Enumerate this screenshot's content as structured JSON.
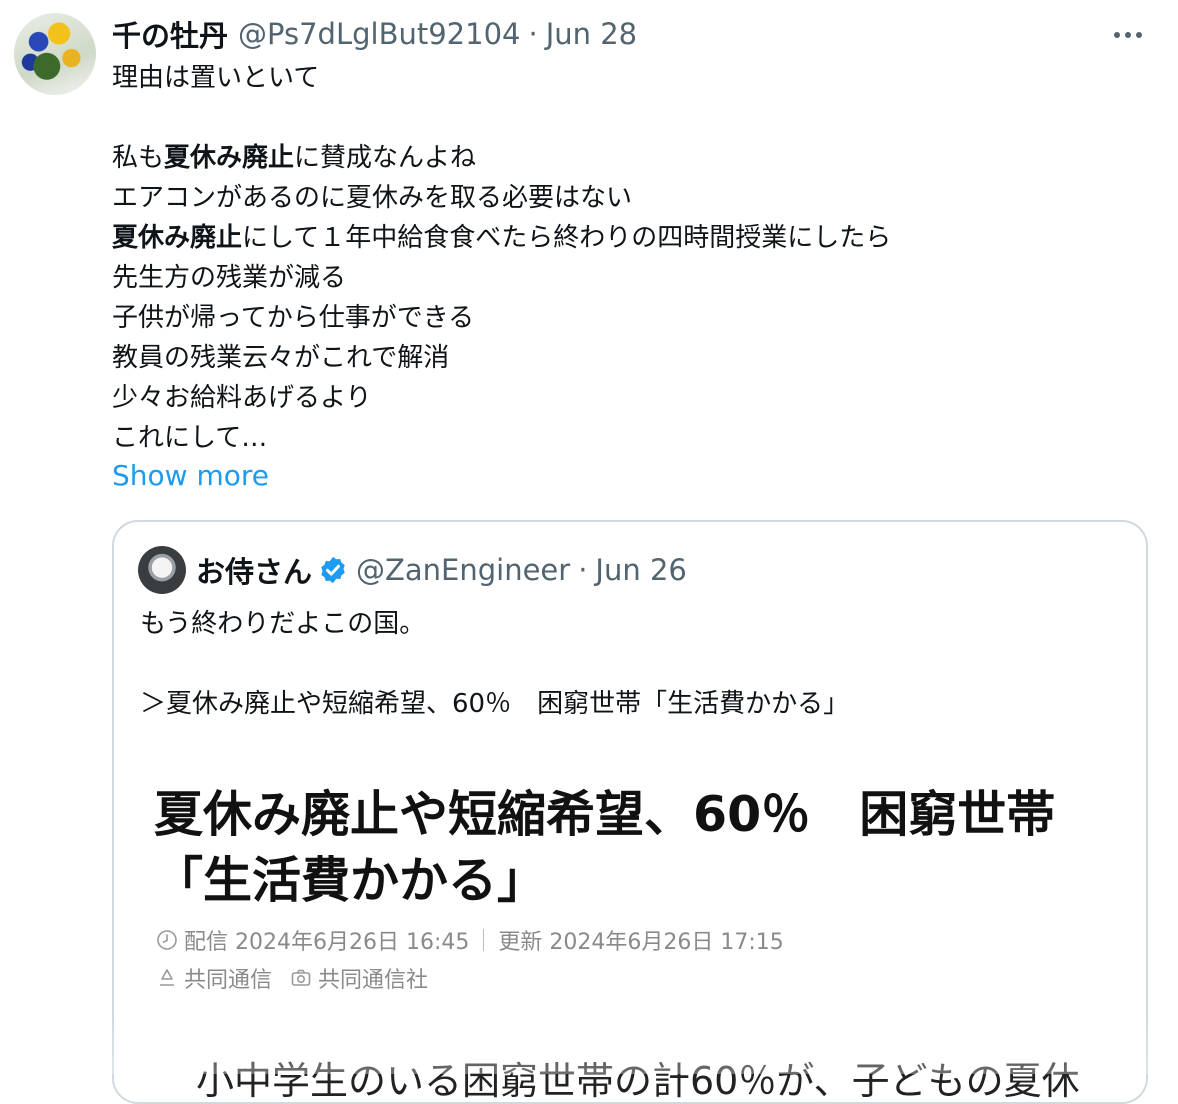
{
  "tweet": {
    "author": {
      "display_name": "千の牡丹",
      "handle": "@Ps7dLglBut92104",
      "separator": "·",
      "date": "Jun 28"
    },
    "body": {
      "line1": "理由は置いといて",
      "line3_pre": "私も",
      "line3_bold": "夏休み廃止",
      "line3_post": "に賛成なんよね",
      "line4": "エアコンがあるのに夏休みを取る必要はない",
      "line5_bold": "夏休み廃止",
      "line5_post": "にして１年中給食食べたら終わりの四時間授業にしたら",
      "line6": "先生方の残業が減る",
      "line7": "子供が帰ってから仕事ができる",
      "line8": "教員の残業云々がこれで解消",
      "line9": "少々お給料あげるより",
      "line10": "これにして…"
    },
    "show_more": "Show more"
  },
  "quote": {
    "author": {
      "display_name": "お侍さん",
      "handle": "@ZanEngineer",
      "separator": "·",
      "date": "Jun 26"
    },
    "text": {
      "line1": "もう終わりだよこの国。",
      "line3": "＞夏休み廃止や短縮希望、60％　困窮世帯「生活費かかる」"
    },
    "article": {
      "headline_line1": "夏休み廃止や短縮希望、60％　困窮世帯",
      "headline_line2": "「生活費かかる」",
      "published": "配信 2024年6月26日 16:45",
      "updated": "更新 2024年6月26日 17:15",
      "source": "共同通信",
      "photo_credit": "共同通信社",
      "lead": "小中学生のいる困窮世帯の計60％が、子どもの夏休"
    }
  },
  "colors": {
    "link": "#1d9bf0",
    "muted": "#536471",
    "border": "#cfd9de",
    "verified": "#1d9bf0"
  },
  "icons": {
    "more": "more-horizontal-icon",
    "verified": "verified-badge-icon",
    "clock": "clock-icon",
    "source": "source-icon",
    "camera": "camera-icon"
  }
}
